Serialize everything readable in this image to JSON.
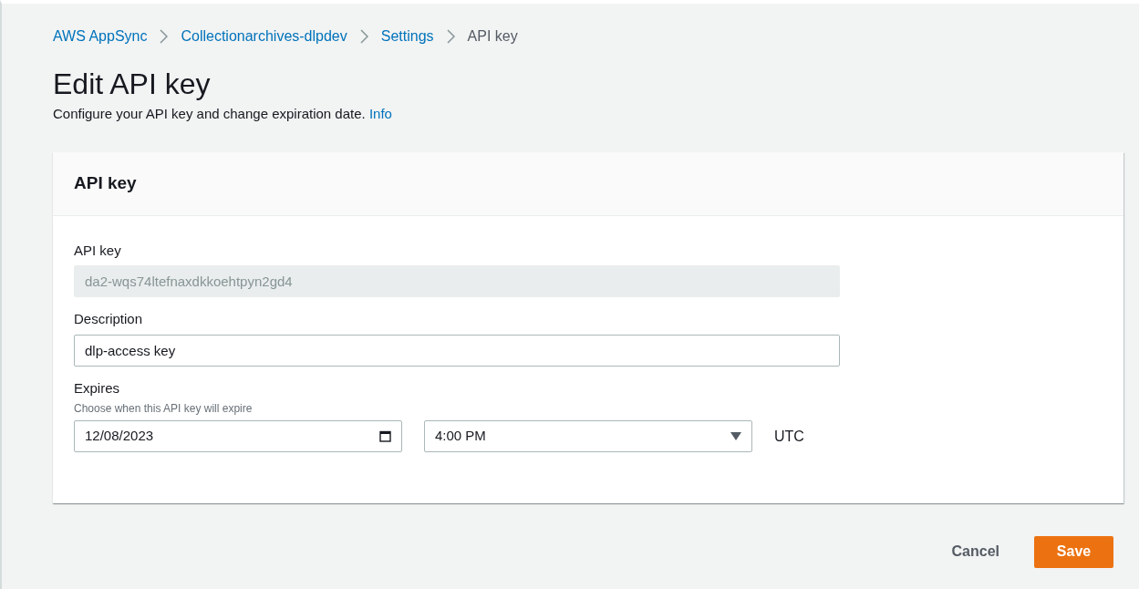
{
  "breadcrumb": [
    {
      "label": "AWS AppSync",
      "link": true
    },
    {
      "label": "Collectionarchives-dlpdev",
      "link": true
    },
    {
      "label": "Settings",
      "link": true
    },
    {
      "label": "API key",
      "link": false
    }
  ],
  "page": {
    "title": "Edit API key",
    "description": "Configure your API key and change expiration date.",
    "info_link": "Info"
  },
  "card": {
    "title": "API key",
    "api_key": {
      "label": "API key",
      "value": "da2-wqs74ltefnaxdkkoehtpyn2gd4",
      "disabled": true
    },
    "description": {
      "label": "Description",
      "value": "dlp-access key",
      "disabled": false
    },
    "expires": {
      "label": "Expires",
      "hint": "Choose when this API key will expire",
      "date": "12/08/2023",
      "time": "4:00 PM",
      "timezone": "UTC"
    }
  },
  "actions": {
    "cancel": "Cancel",
    "save": "Save"
  }
}
